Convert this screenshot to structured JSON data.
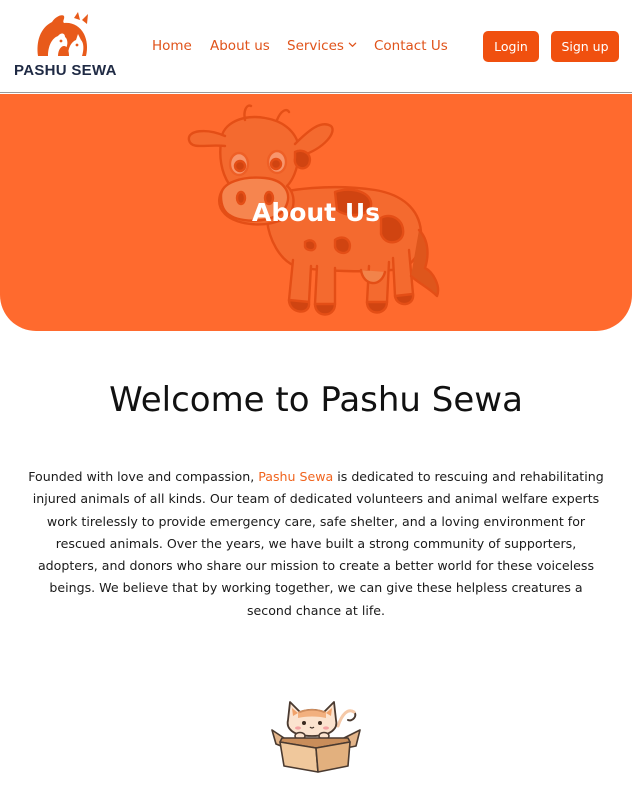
{
  "header": {
    "brand": "PASHU SEWA",
    "nav": {
      "home": "Home",
      "about": "About us",
      "services": "Services",
      "contact": "Contact Us"
    },
    "buttons": {
      "login": "Login",
      "signup": "Sign up"
    }
  },
  "hero": {
    "title": "About Us"
  },
  "main": {
    "heading": "Welcome to Pashu Sewa",
    "intro_before": "Founded with love and compassion, ",
    "intro_highlight": "Pashu Sewa",
    "intro_after": " is dedicated to rescuing and rehabilitating injured animals of all kinds. Our team of dedicated volunteers and animal welfare experts work tirelessly to provide emergency care, safe shelter, and a loving environment for rescued animals. Over the years, we have built a strong community of supporters, adopters, and donors who share our mission to create a better world for these voiceless beings. We believe that by working together, we can give these helpless creatures a second chance at life."
  },
  "icons": {
    "logo": "animals-logo-icon",
    "services_dropdown": "chevron-down-icon",
    "hero_illustration": "cow-illustration",
    "cat_illustration": "cat-in-box-illustration"
  },
  "colors": {
    "accent": "#f0500f",
    "hero_bg": "#ff6a2e",
    "nav_text": "#e0531a",
    "brand_text": "#1f2a44"
  }
}
